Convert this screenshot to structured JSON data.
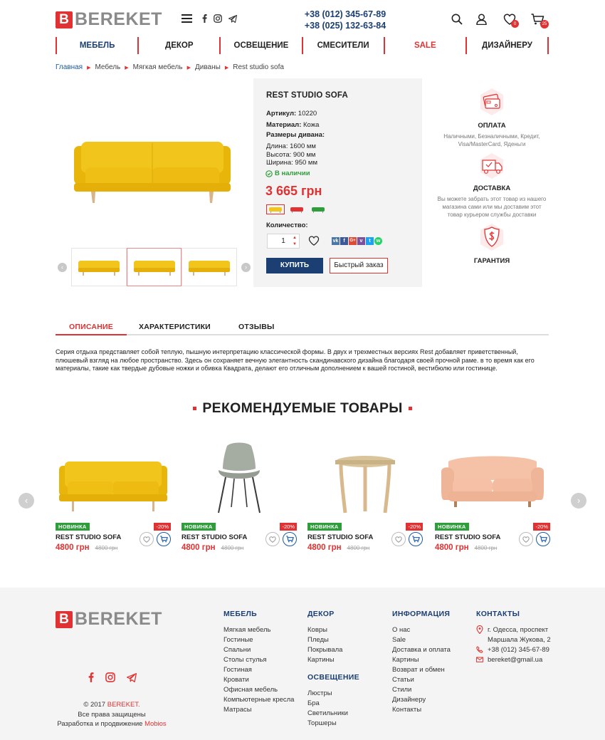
{
  "header": {
    "logo_letter": "B",
    "logo_text": "BEREKET",
    "phone1": "+38 (012) 345-67-89",
    "phone2": "+38 (025) 132-63-84",
    "wishlist_count": "0",
    "cart_count": "25"
  },
  "nav": [
    {
      "label": "МЕБЕЛЬ"
    },
    {
      "label": "ДЕКОР"
    },
    {
      "label": "ОСВЕЩЕНИЕ"
    },
    {
      "label": "СМЕСИТЕЛИ"
    },
    {
      "label": "SALE"
    },
    {
      "label": "ДИЗАЙНЕРУ"
    }
  ],
  "breadcrumb": [
    "Главная",
    "Мебель",
    "Мягкая мебель",
    "Диваны",
    "Rest studio sofa"
  ],
  "product": {
    "name": "REST STUDIO SOFA",
    "article_label": "Артикул:",
    "article": "10220",
    "material_label": "Материал:",
    "material": "Кожа",
    "sizes_label": "Размеры дивана:",
    "length_label": "Длина:",
    "length": "1600 мм",
    "height_label": "Высота:",
    "height": "900 мм",
    "width_label": "Ширина:",
    "width": "950 мм",
    "stock": "В наличии",
    "price": "3 665 грн",
    "qty_label": "Количество:",
    "qty": "1",
    "buy_label": "КУПИТЬ",
    "quick_label": "Быстрый заказ",
    "social": [
      "vk",
      "f",
      "G+",
      "v",
      "t",
      "w"
    ],
    "colors": [
      "#f2c21b",
      "#e03232",
      "#2e9e3a"
    ]
  },
  "features": [
    {
      "title": "ОПЛАТА",
      "desc": "Наличными, Безналичными, Кредит, Visa/MasterCard, Яденьги"
    },
    {
      "title": "ДОСТАВКА",
      "desc": "Вы можете забрать этот товар из нашего магазина сами или мы доставим этот товар курьером службы доставки"
    },
    {
      "title": "ГАРАНТИЯ",
      "desc": ""
    }
  ],
  "tabs": [
    "ОПИСАНИЕ",
    "ХАРАКТЕРИСТИКИ",
    "ОТЗЫВЫ"
  ],
  "description": "Серия отдыха представляет собой теплую, пышную интерпретацию классической формы. В двух и трехместных версиях Rest добавляет приветственный, плюшевый взгляд на любое пространство. Здесь он сохраняет вечную элегантность скандинавского дизайна благодаря своей прочной раме. в то время как его материалы, такие как твердые дубовые ножки и обивка Квадрата, делают его отличным дополнением к вашей гостиной, вестибюлю или гостинице.",
  "recommended": {
    "title": "РЕКОМЕНДУЕМЫЕ ТОВАРЫ",
    "items": [
      {
        "badge_new": "НОВИНКА",
        "badge_sale": "-20%",
        "name": "REST STUDIO SOFA",
        "price": "4800 грн",
        "old_price": "4800 грн",
        "kind": "sofa"
      },
      {
        "badge_new": "НОВИНКА",
        "badge_sale": "-20%",
        "name": "REST STUDIO SOFA",
        "price": "4800 грн",
        "old_price": "4800 грн",
        "kind": "chair"
      },
      {
        "badge_new": "НОВИНКА",
        "badge_sale": "-20%",
        "name": "REST STUDIO SOFA",
        "price": "4800 грн",
        "old_price": "4800 грн",
        "kind": "table"
      },
      {
        "badge_new": "НОВИНКА",
        "badge_sale": "-20%",
        "name": "REST STUDIO SOFA",
        "price": "4800 грн",
        "old_price": "4800 грн",
        "kind": "pinksofa"
      }
    ]
  },
  "footer": {
    "copyright_prefix": "© 2017",
    "copyright_brand": "BEREKET.",
    "rights": "Все права защищены",
    "dev_prefix": "Разработка и продвижение",
    "dev_brand": "Mobios",
    "col_furniture": {
      "title": "МЕБЕЛЬ",
      "items": [
        "Мягкая мебель",
        "Гостиные",
        "Спальни",
        "Столы стулья",
        "Гостиная",
        "Кровати",
        "Офисная мебель",
        "Компьютерные кресла",
        "Матрасы"
      ]
    },
    "col_decor": {
      "title": "ДЕКОР",
      "items": [
        "Ковры",
        "Пледы",
        "Покрывала",
        "Картины"
      ]
    },
    "col_light": {
      "title": "ОСВЕЩЕНИЕ",
      "items": [
        "Люстры",
        "Бра",
        "Светильники",
        "Торшеры"
      ]
    },
    "col_info": {
      "title": "ИНФОРМАЦИЯ",
      "items": [
        "О нас",
        "Sale",
        "Доставка и оплата",
        "Картины",
        "Возврат и обмен",
        "Статьи",
        "Стили",
        "Дизайнеру",
        "Контакты"
      ]
    },
    "col_contacts": {
      "title": "КОНТАКТЫ",
      "address1": "г. Одесса, проспект",
      "address2": "Маршала Жукова, 2",
      "phone": "+38 (012) 345-67-89",
      "email": "bereket@gmail.ua"
    }
  }
}
